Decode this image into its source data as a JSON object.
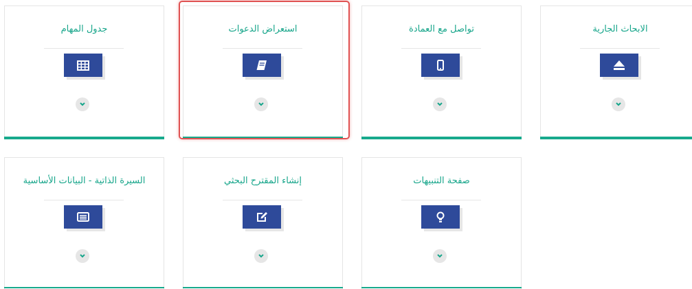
{
  "cards": [
    {
      "label": "الابحاث الجارية",
      "icon": "eject-icon"
    },
    {
      "label": "تواصل مع العمادة",
      "icon": "mobile-icon"
    },
    {
      "label": "استعراض الدعوات",
      "icon": "book-icon",
      "selected": true
    },
    {
      "label": "جدول المهام",
      "icon": "table-icon"
    },
    {
      "label": "صفحة التنبيهات",
      "icon": "lightbulb-icon"
    },
    {
      "label": "إنشاء المقترح البحثي",
      "icon": "edit-icon"
    },
    {
      "label": "السيرة الذاتية - البيانات الأساسية",
      "icon": "id-card-icon"
    }
  ],
  "colors": {
    "accent": "#17a98c",
    "icon_bg": "#2e4a9a",
    "highlight": "#e05252"
  }
}
